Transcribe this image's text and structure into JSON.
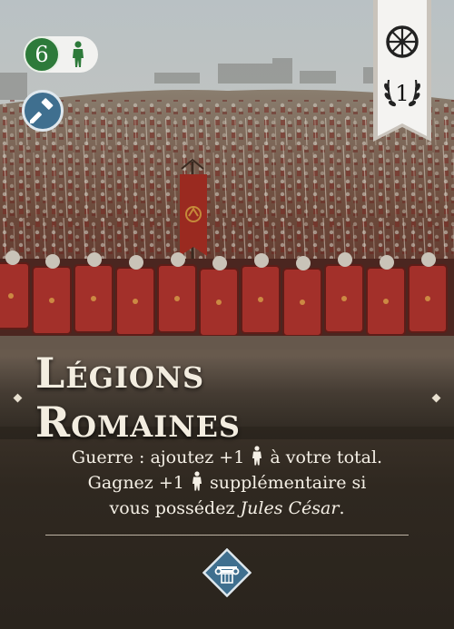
{
  "card": {
    "title": "Légions Romaines",
    "cost": {
      "value": "6",
      "icon": "person-icon",
      "color": "#2d7a3a"
    },
    "type_icon": "hammer-icon",
    "ribbon": {
      "top_icon": "wheel-icon",
      "age_number": "1"
    },
    "effect": {
      "line1_before": "Guerre : ajoutez +1",
      "line1_after": "à votre total.",
      "line2_before": "Gagnez +1",
      "line2_after": "supplémentaire si",
      "line3_before": "vous possédez",
      "line3_italic": "Jules César",
      "line3_after": "."
    },
    "bottom_icon": "column-capital-icon"
  }
}
